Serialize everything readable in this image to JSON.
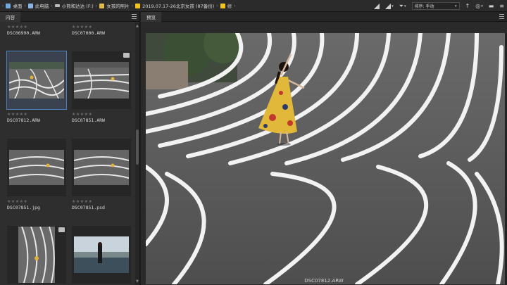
{
  "breadcrumb": {
    "items": [
      {
        "label": "桌面",
        "icon": "desktop-icon"
      },
      {
        "label": "此电脑",
        "icon": "computer-icon"
      },
      {
        "label": "小熊和达达 (F:)",
        "icon": "drive-icon"
      },
      {
        "label": "女孩的照片",
        "icon": "folder-icon"
      },
      {
        "label": "2019.07.17-26北京女孩 (87备份)",
        "icon": "folder-icon"
      },
      {
        "label": "修",
        "icon": "folder-icon"
      }
    ]
  },
  "toolbar": {
    "sort_label": "排序: 手动",
    "icons": [
      "quality-icon",
      "rating-filter-icon",
      "filter-icon",
      "sort-order-icon",
      "view-options-icon",
      "new-folder-icon",
      "menu-icon"
    ]
  },
  "content_panel": {
    "tab": "内容",
    "items": [
      {
        "name": "DSC06990.ARW",
        "selected": false
      },
      {
        "name": "DSC07000.ARW",
        "selected": false
      },
      {
        "name": "DSC07812.ARW",
        "selected": true
      },
      {
        "name": "DSC07851.ARW",
        "selected": false
      },
      {
        "name": "DSC07851.jpg",
        "selected": false
      },
      {
        "name": "DSC07851.psd",
        "selected": false
      },
      {
        "name": "",
        "selected": false
      },
      {
        "name": "",
        "selected": false
      }
    ]
  },
  "preview_panel": {
    "tab": "预览",
    "caption": "DSC07812.ARW"
  },
  "colors": {
    "accent": "#4c7fc4",
    "panel": "#2e2e2e",
    "background": "#1e1e1e"
  }
}
